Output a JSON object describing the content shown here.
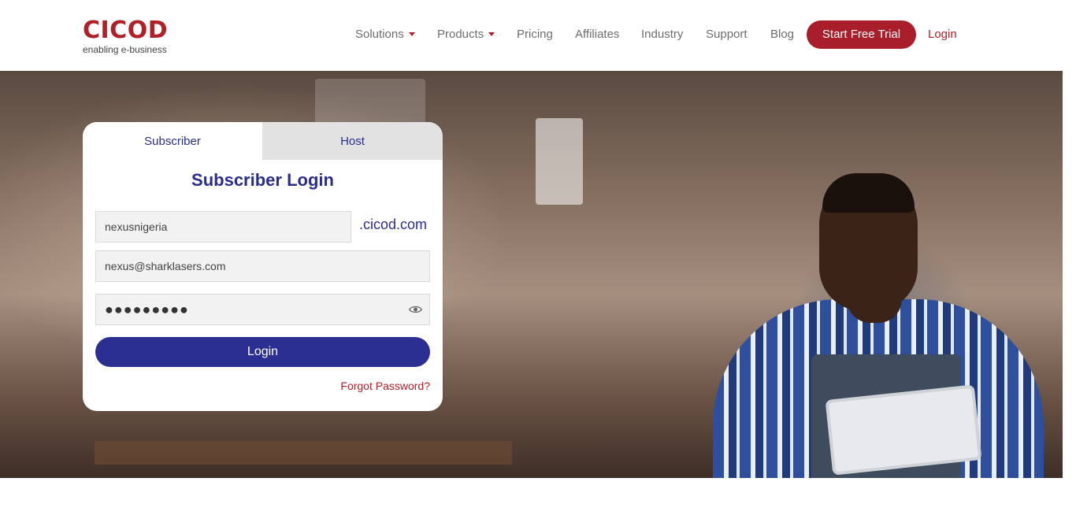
{
  "brand": {
    "name": "CICOD",
    "tagline": "enabling e-business",
    "accent_color": "#b02028",
    "primary_color": "#2c2f92"
  },
  "nav": {
    "items": [
      {
        "label": "Solutions",
        "dropdown": true
      },
      {
        "label": "Products",
        "dropdown": true
      },
      {
        "label": "Pricing",
        "dropdown": false
      },
      {
        "label": "Affiliates",
        "dropdown": false
      },
      {
        "label": "Industry",
        "dropdown": false
      },
      {
        "label": "Support",
        "dropdown": false
      },
      {
        "label": "Blog",
        "dropdown": false
      }
    ],
    "cta_label": "Start Free Trial",
    "login_label": "Login"
  },
  "login": {
    "tabs": [
      "Subscriber",
      "Host"
    ],
    "active_tab": "Subscriber",
    "title": "Subscriber Login",
    "domain_value": "nexusnigeria",
    "domain_suffix": ".cicod.com",
    "email_value": "nexus@sharklasers.com",
    "password_masked": "●●●●●●●●●",
    "submit_label": "Login",
    "forgot_label": "Forgot Password?",
    "password_toggle_icon": "eye-icon"
  }
}
